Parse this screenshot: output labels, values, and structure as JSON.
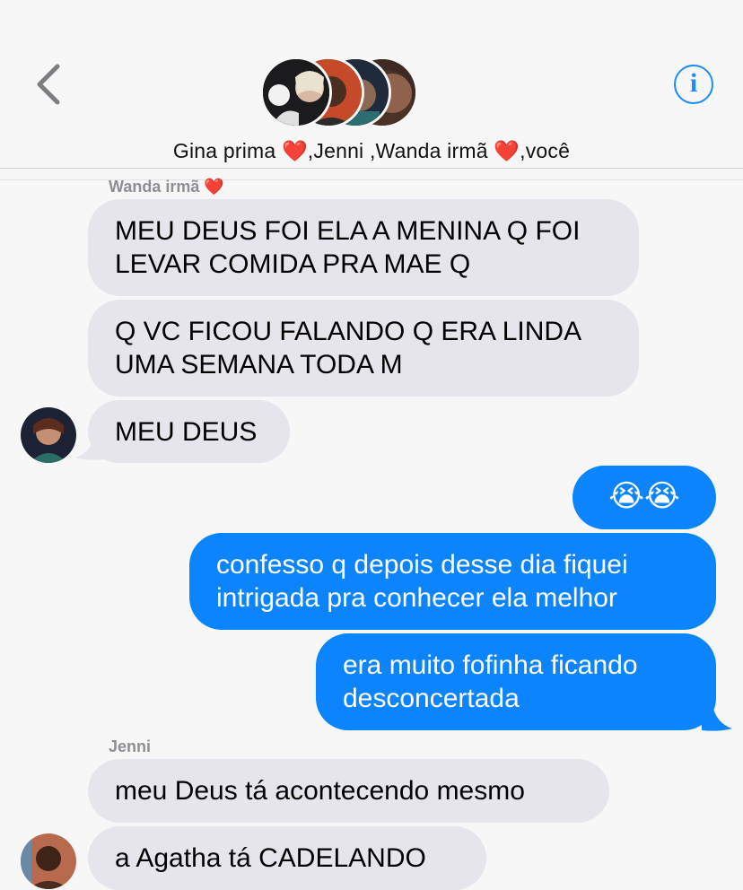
{
  "header": {
    "title_parts": [
      "Gina prima ",
      "❤️",
      ",Jenni ,Wanda irmã ",
      "❤️",
      ",você"
    ],
    "back_icon": "chevron-left-icon",
    "info_icon": "info-icon",
    "info_glyph": "i"
  },
  "colors": {
    "incoming_bubble": "#e6e5eb",
    "outgoing_bubble": "#0b84fe",
    "accent": "#1a8cff",
    "heart": "#e8202a"
  },
  "messages": [
    {
      "sender_label": "Wanda irmã ❤️",
      "text_lines": [
        "MEU DEUS FOI ELA A MENINA Q FOI",
        "LEVAR COMIDA PRA MAE Q"
      ],
      "direction": "in"
    },
    {
      "text_lines": [
        "Q VC FICOU FALANDO Q ERA LINDA",
        "UMA SEMANA TODA M"
      ],
      "direction": "in"
    },
    {
      "text_lines": [
        "MEU DEUS"
      ],
      "direction": "in"
    },
    {
      "text_lines": [
        "😭😭"
      ],
      "direction": "out"
    },
    {
      "text_lines": [
        "confesso q depois desse dia fiquei",
        "intrigada pra conhecer ela melhor"
      ],
      "direction": "out"
    },
    {
      "text_lines": [
        "era muito fofinha ficando",
        "desconcertada"
      ],
      "direction": "out"
    },
    {
      "sender_label": "Jenni",
      "text_lines": [
        "meu Deus tá acontecendo mesmo"
      ],
      "direction": "in"
    },
    {
      "text_lines": [
        "a Agatha tá CADELANDO"
      ],
      "direction": "in"
    }
  ]
}
